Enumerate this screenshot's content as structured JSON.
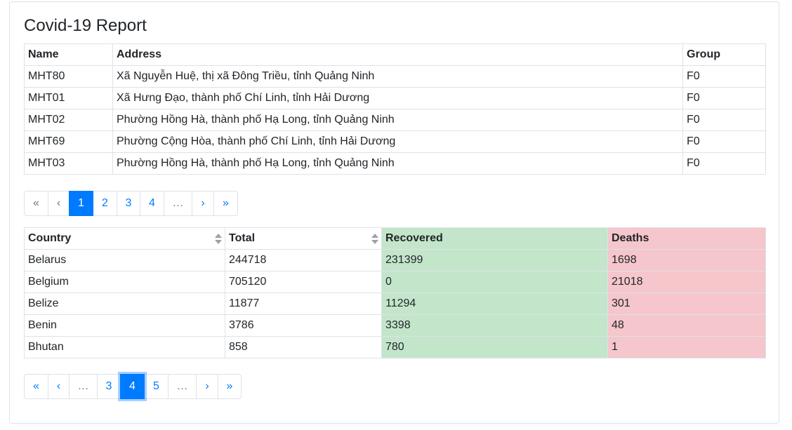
{
  "title": "Covid-19 Report",
  "report": {
    "headers": [
      "Name",
      "Address",
      "Group"
    ],
    "rows": [
      [
        "MHT80",
        "Xã Nguyễn Huệ, thị xã Đông Triều, tỉnh Quảng Ninh",
        "F0"
      ],
      [
        "MHT01",
        "Xã Hưng Đạo, thành phố Chí Linh, tỉnh Hải Dương",
        "F0"
      ],
      [
        "MHT02",
        "Phường Hồng Hà, thành phố Hạ Long, tỉnh Quảng Ninh",
        "F0"
      ],
      [
        "MHT69",
        "Phường Cộng Hòa, thành phố Chí Linh, tỉnh Hải Dương",
        "F0"
      ],
      [
        "MHT03",
        "Phường Hồng Hà, thành phố Hạ Long, tỉnh Quảng Ninh",
        "F0"
      ]
    ],
    "pagination": [
      "«",
      "‹",
      "1",
      "2",
      "3",
      "4",
      "…",
      "›",
      "»"
    ]
  },
  "stats": {
    "headers": [
      "Country",
      "Total",
      "Recovered",
      "Deaths"
    ],
    "rows": [
      [
        "Belarus",
        "244718",
        "231399",
        "1698"
      ],
      [
        "Belgium",
        "705120",
        "0",
        "21018"
      ],
      [
        "Belize",
        "11877",
        "11294",
        "301"
      ],
      [
        "Benin",
        "3786",
        "3398",
        "48"
      ],
      [
        "Bhutan",
        "858",
        "780",
        "1"
      ]
    ],
    "pagination": [
      "«",
      "‹",
      "…",
      "3",
      "4",
      "5",
      "…",
      "›",
      "»"
    ]
  },
  "colors": {
    "recovered": "#c3e6cb",
    "deaths": "#f5c6cb",
    "accent": "#007bff"
  }
}
